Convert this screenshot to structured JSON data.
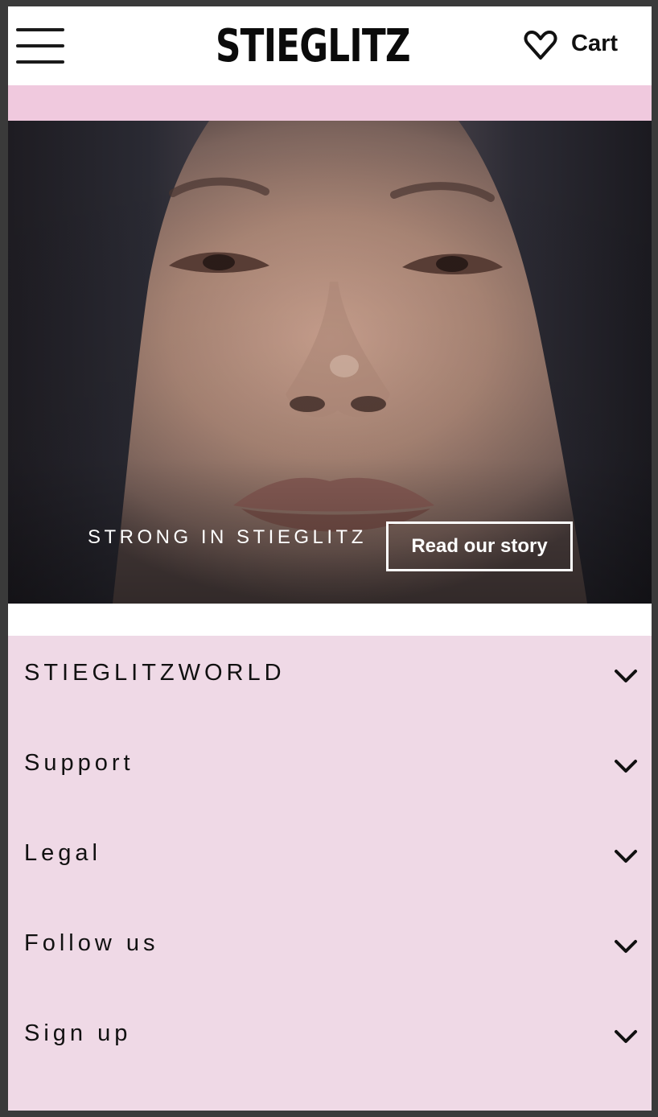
{
  "header": {
    "brand": "STIEGLITZ",
    "cart_label": "Cart",
    "icons": {
      "menu": "hamburger-menu-icon",
      "wishlist": "heart-icon"
    }
  },
  "hero": {
    "caption": "STRONG IN STIEGLITZ",
    "cta_label": "Read our story"
  },
  "footer": {
    "sections": [
      {
        "label": "STIEGLITZWORLD",
        "icon": "chevron-down-icon"
      },
      {
        "label": "Support",
        "icon": "chevron-down-icon"
      },
      {
        "label": "Legal",
        "icon": "chevron-down-icon"
      },
      {
        "label": "Follow us",
        "icon": "chevron-down-icon"
      },
      {
        "label": "Sign up",
        "icon": "chevron-down-icon"
      }
    ]
  },
  "colors": {
    "promo_band": "#f0c9de",
    "footer_bg": "#efd9e6",
    "text": "#111111"
  }
}
